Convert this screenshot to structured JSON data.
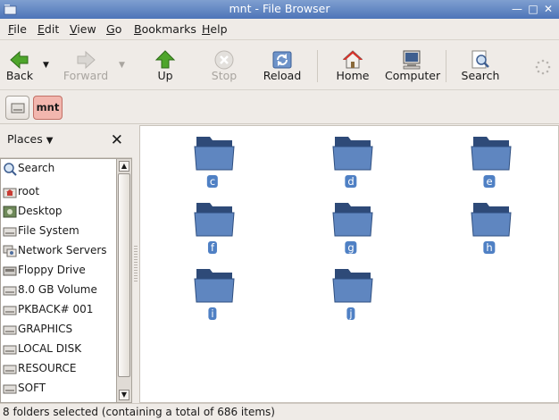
{
  "window": {
    "title": "mnt - File Browser"
  },
  "menu": [
    {
      "label": "File",
      "key": "F",
      "rest": "ile"
    },
    {
      "label": "Edit",
      "key": "E",
      "rest": "dit"
    },
    {
      "label": "View",
      "key": "V",
      "rest": "iew"
    },
    {
      "label": "Go",
      "key": "G",
      "rest": "o"
    },
    {
      "label": "Bookmarks",
      "key": "B",
      "rest": "ookmarks"
    },
    {
      "label": "Help",
      "key": "H",
      "rest": "elp"
    }
  ],
  "toolbar": {
    "back": "Back",
    "forward": "Forward",
    "up": "Up",
    "stop": "Stop",
    "reload": "Reload",
    "home": "Home",
    "computer": "Computer",
    "search": "Search"
  },
  "location": {
    "current": "mnt"
  },
  "sidebar": {
    "header": "Places",
    "items": [
      {
        "label": "Search",
        "icon": "search-icon"
      },
      {
        "label": "root",
        "icon": "home-folder-icon"
      },
      {
        "label": "Desktop",
        "icon": "desktop-icon"
      },
      {
        "label": "File System",
        "icon": "drive-icon"
      },
      {
        "label": "Network Servers",
        "icon": "network-icon"
      },
      {
        "label": "Floppy Drive",
        "icon": "floppy-icon"
      },
      {
        "label": "8.0 GB Volume",
        "icon": "drive-icon"
      },
      {
        "label": "PKBACK# 001",
        "icon": "drive-icon"
      },
      {
        "label": "GRAPHICS",
        "icon": "drive-icon"
      },
      {
        "label": "LOCAL DISK",
        "icon": "drive-icon"
      },
      {
        "label": "RESOURCE",
        "icon": "drive-icon"
      },
      {
        "label": "SOFT",
        "icon": "drive-icon"
      }
    ]
  },
  "folders": [
    "c",
    "d",
    "e",
    "f",
    "g",
    "h",
    "i",
    "j"
  ],
  "status": {
    "text": "8 folders selected (containing a total of 686 items)"
  },
  "colors": {
    "selection": "#4f80c4",
    "titlebar": "#4d74b8",
    "active_path": "#f2b6ae"
  }
}
